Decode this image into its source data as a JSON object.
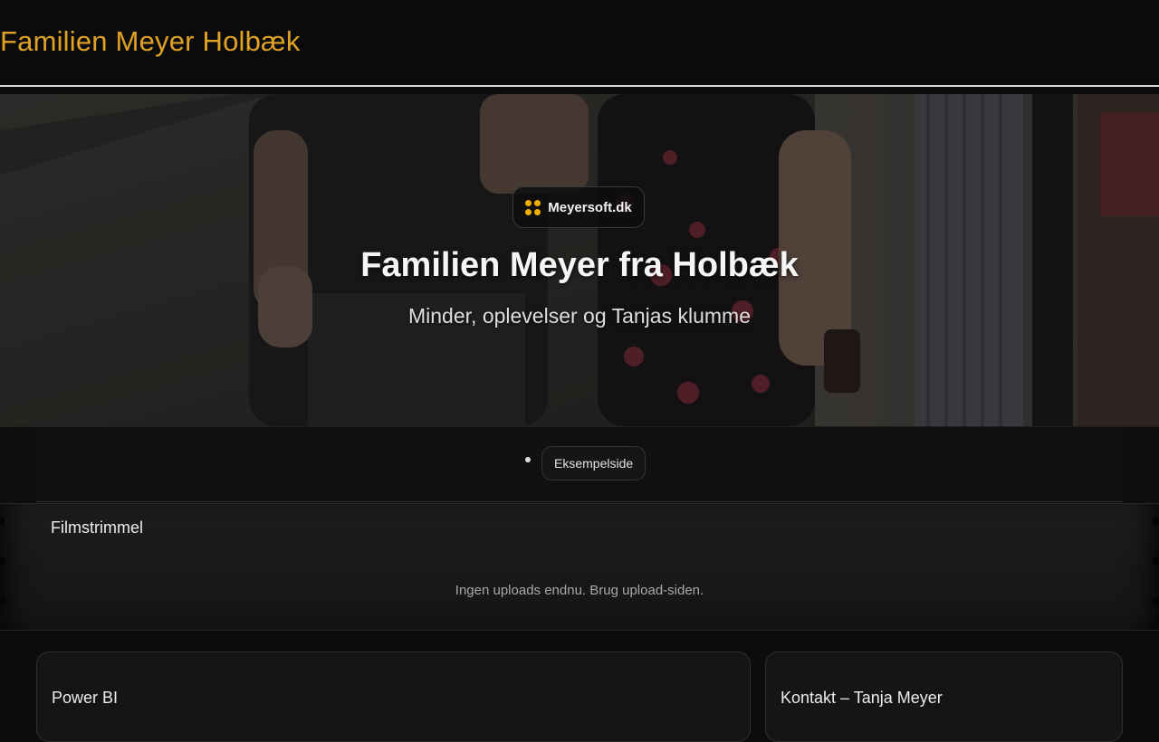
{
  "header": {
    "site_title": "Familien Meyer Holbæk"
  },
  "hero": {
    "badge_icon": "four-dots-logo-icon",
    "badge_text": "Meyersoft.dk",
    "accent_color": "#f2b000",
    "title": "Familien Meyer fra Holbæk",
    "subtitle": "Minder, oplevelser og Tanjas klumme"
  },
  "nav": {
    "items": [
      {
        "label": "Eksempelside"
      }
    ]
  },
  "filmstrip": {
    "title": "Filmstrimmel",
    "empty_message": "Ingen uploads endnu. Brug upload-siden."
  },
  "cards": [
    {
      "title": "Power BI"
    },
    {
      "title": "Kontakt – Tanja Meyer"
    }
  ],
  "colors": {
    "accent": "#e0a224",
    "background": "#0c0c0c"
  }
}
